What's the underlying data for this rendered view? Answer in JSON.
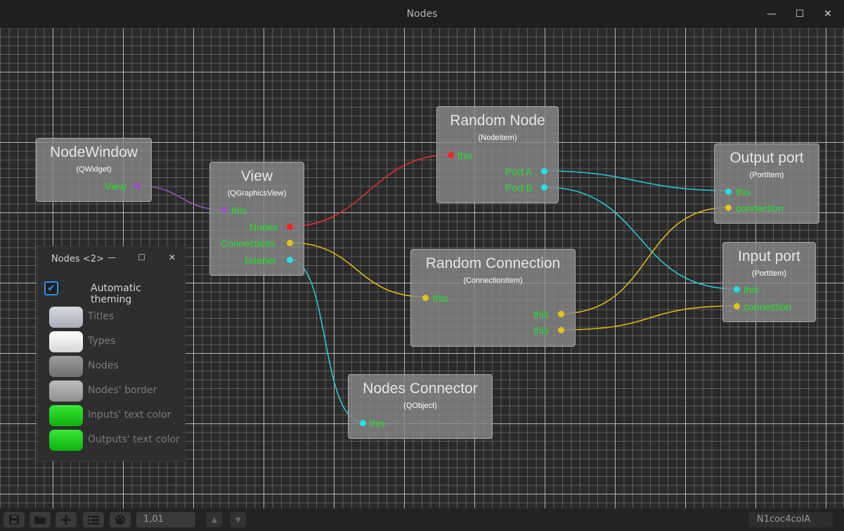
{
  "window": {
    "title": "Nodes",
    "controls": [
      "—",
      "☐",
      "✕"
    ]
  },
  "nodes": {
    "node_window": {
      "title": "NodeWindow",
      "type": "(QWidget)",
      "outputs": [
        "View"
      ]
    },
    "view": {
      "title": "View",
      "type": "(QGraphicsView)",
      "inputs": [
        "this"
      ],
      "outputs": [
        "Nodes",
        "Connections",
        "listener"
      ]
    },
    "random_node": {
      "title": "Random Node",
      "type": "(NodeItem)",
      "inputs": [
        "this"
      ],
      "outputs": [
        "Port A",
        "Port B"
      ]
    },
    "random_connection": {
      "title": "Random Connection",
      "type": "(ConnectionItem)",
      "inputs": [
        "this"
      ],
      "outputs": [
        "this",
        "this"
      ]
    },
    "nodes_connector": {
      "title": "Nodes Connector",
      "type": "(QObject)",
      "inputs": [
        "this"
      ]
    },
    "output_port": {
      "title": "Output port",
      "type": "(PortItem)",
      "inputs": [
        "this",
        "connection"
      ]
    },
    "input_port": {
      "title": "Input port",
      "type": "(PortItem)",
      "inputs": [
        "this",
        "connection"
      ]
    }
  },
  "colors": {
    "port_purple": "#9b4fc4",
    "port_red": "#ff2020",
    "port_cyan": "#22e0e8",
    "port_yellow": "#e3c41a",
    "wire_purple": "#9a55c0",
    "wire_red": "#d93030",
    "wire_cyan": "#2ac8d0",
    "wire_yellow": "#d8b818",
    "port_text": "#22e02a"
  },
  "dialog": {
    "title": "Nodes <2>",
    "controls": [
      "—",
      "☐",
      "✕"
    ],
    "auto_theming_label": "Automatic theming",
    "auto_theming_checked": true,
    "swatches": [
      {
        "label": "Titles",
        "color": "#c2c5ce"
      },
      {
        "label": "Types",
        "color": "#ececec"
      },
      {
        "label": "Nodes",
        "color": "#8a8a8a"
      },
      {
        "label": "Nodes' border",
        "color": "#a9a9a9"
      },
      {
        "label": "Inputs' text color",
        "color": "#1fd01f"
      },
      {
        "label": "Outputs' text color",
        "color": "#1fd01f"
      }
    ]
  },
  "toolbar": {
    "buttons": [
      "save-icon",
      "open-folder-icon",
      "add-icon",
      "list-icon",
      "palette-icon"
    ],
    "zoom_value": "1,01",
    "status_text": "N1coc4colA"
  }
}
